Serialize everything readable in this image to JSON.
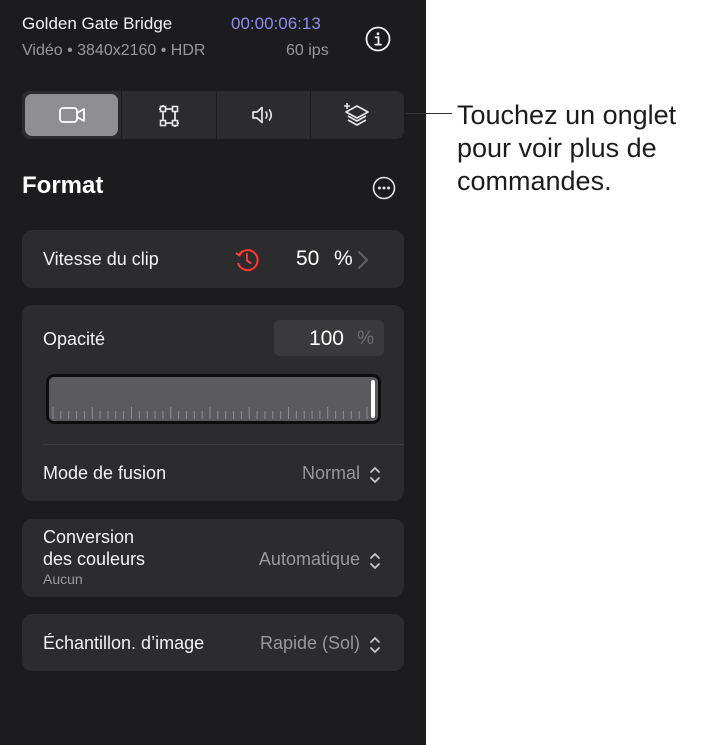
{
  "header": {
    "title": "Golden Gate Bridge",
    "timecode": "00:00:06:13",
    "meta": "Vidéo • 3840x2160 • HDR",
    "fps": "60 ips"
  },
  "tabs": [
    {
      "icon": "video-camera-icon",
      "active": true
    },
    {
      "icon": "transform-icon",
      "active": false
    },
    {
      "icon": "speaker-icon",
      "active": false
    },
    {
      "icon": "layers-icon",
      "active": false
    }
  ],
  "section": {
    "title": "Format"
  },
  "clip_speed": {
    "label": "Vitesse du clip",
    "value": "50",
    "unit": "%",
    "icon": "speed-clock-icon",
    "icon_color": "#ff3b30"
  },
  "opacity": {
    "label": "Opacité",
    "value": "100",
    "unit": "%",
    "slider_fraction": 1.0
  },
  "blend_mode": {
    "label": "Mode de fusion",
    "value": "Normal"
  },
  "color_conversion": {
    "label_line1": "Conversion",
    "label_line2": "des couleurs",
    "sub": "Aucun",
    "value": "Automatique"
  },
  "frame_sampling": {
    "label": "Échantillon. d’image",
    "value": "Rapide (Sol)"
  },
  "callout": {
    "text": "Touchez un onglet pour voir plus de commandes."
  },
  "colors": {
    "panel_bg": "#1c1c1e",
    "card_bg": "#2c2c2e",
    "accent_time": "#8e8cf0",
    "speed_icon": "#ff3b30"
  }
}
